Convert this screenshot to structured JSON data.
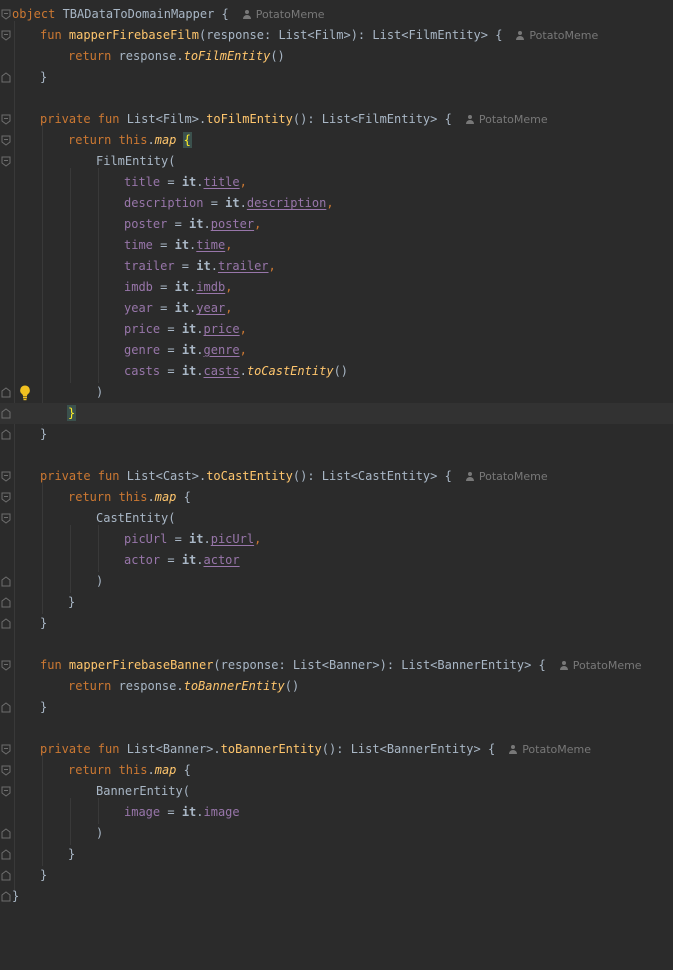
{
  "author_hint": "PotatoMeme",
  "lines": {
    "l1": {
      "kw1": "object",
      "name": " TBADataToDomainMapper",
      "rest": " {"
    },
    "l2": {
      "kw1": "fun",
      "fn": "mapperFirebaseFilm",
      "p1": "(",
      "param": "response",
      "rest": ": List<Film>): List<FilmEntity> {"
    },
    "l3": {
      "kw1": "return",
      "a": " response.",
      "ext": "toFilmEntity",
      "b": "()"
    },
    "l4": {
      "a": "}"
    },
    "l6": {
      "kw1": "private fun",
      "a": " List<Film>.",
      "fn": "toFilmEntity",
      "b": "(): List<FilmEntity> {"
    },
    "l7": {
      "kw1": "return",
      "kw2": " this",
      "a": ".",
      "ext": "map",
      "b": " ",
      "br": "{"
    },
    "l8": {
      "a": "FilmEntity("
    },
    "l9": {
      "p": "title",
      "a": " = ",
      "it": "it",
      "d": ".",
      "prop": "title",
      "c": ","
    },
    "l10": {
      "p": "description",
      "a": " = ",
      "it": "it",
      "d": ".",
      "prop": "description",
      "c": ","
    },
    "l11": {
      "p": "poster",
      "a": " = ",
      "it": "it",
      "d": ".",
      "prop": "poster",
      "c": ","
    },
    "l12": {
      "p": "time",
      "a": " = ",
      "it": "it",
      "d": ".",
      "prop": "time",
      "c": ","
    },
    "l13": {
      "p": "trailer",
      "a": " = ",
      "it": "it",
      "d": ".",
      "prop": "trailer",
      "c": ","
    },
    "l14": {
      "p": "imdb",
      "a": " = ",
      "it": "it",
      "d": ".",
      "prop": "imdb",
      "c": ","
    },
    "l15": {
      "p": "year",
      "a": " = ",
      "it": "it",
      "d": ".",
      "prop": "year",
      "c": ","
    },
    "l16": {
      "p": "price",
      "a": " = ",
      "it": "it",
      "d": ".",
      "prop": "price",
      "c": ","
    },
    "l17": {
      "p": "genre",
      "a": " = ",
      "it": "it",
      "d": ".",
      "prop": "genre",
      "c": ","
    },
    "l18": {
      "p": "casts",
      "a": " = ",
      "it": "it",
      "d": ".",
      "prop": "casts",
      "e": ".",
      "ext": "toCastEntity",
      "c": "()"
    },
    "l19": {
      "a": ")"
    },
    "l20": {
      "br": "}"
    },
    "l21": {
      "a": "}"
    },
    "l23": {
      "kw1": "private fun",
      "a": " List<Cast>.",
      "fn": "toCastEntity",
      "b": "(): List<CastEntity> {"
    },
    "l24": {
      "kw1": "return",
      "kw2": " this",
      "a": ".",
      "ext": "map",
      "b": " {"
    },
    "l25": {
      "a": "CastEntity("
    },
    "l26": {
      "p": "picUrl",
      "a": " = ",
      "it": "it",
      "d": ".",
      "prop": "picUrl",
      "c": ","
    },
    "l27": {
      "p": "actor",
      "a": " = ",
      "it": "it",
      "d": ".",
      "prop": "actor"
    },
    "l28": {
      "a": ")"
    },
    "l29": {
      "a": "}"
    },
    "l30": {
      "a": "}"
    },
    "l32": {
      "kw1": "fun",
      "fn": "mapperFirebaseBanner",
      "p1": "(",
      "param": "response",
      "rest": ": List<Banner>): List<BannerEntity> {"
    },
    "l33": {
      "kw1": "return",
      "a": " response.",
      "ext": "toBannerEntity",
      "b": "()"
    },
    "l34": {
      "a": "}"
    },
    "l36": {
      "kw1": "private fun",
      "a": " List<Banner>.",
      "fn": "toBannerEntity",
      "b": "(): List<BannerEntity> {"
    },
    "l37": {
      "kw1": "return",
      "kw2": " this",
      "a": ".",
      "ext": "map",
      "b": " {"
    },
    "l38": {
      "a": "BannerEntity("
    },
    "l39": {
      "p": "image",
      "a": " = ",
      "it": "it",
      "d": ".",
      "pn": "image"
    },
    "l40": {
      "a": ")"
    },
    "l41": {
      "a": "}"
    },
    "l42": {
      "a": "}"
    },
    "l43": {
      "a": "}"
    }
  },
  "colors": {
    "background": "#2b2b2b",
    "keyword": "#cc7832",
    "function": "#ffc66d",
    "property": "#9876aa",
    "text": "#a9b7c6",
    "hint": "#787878"
  },
  "icons": {
    "fold": "fold-marker-icon",
    "bulb": "lightbulb-icon",
    "author": "person-icon"
  }
}
